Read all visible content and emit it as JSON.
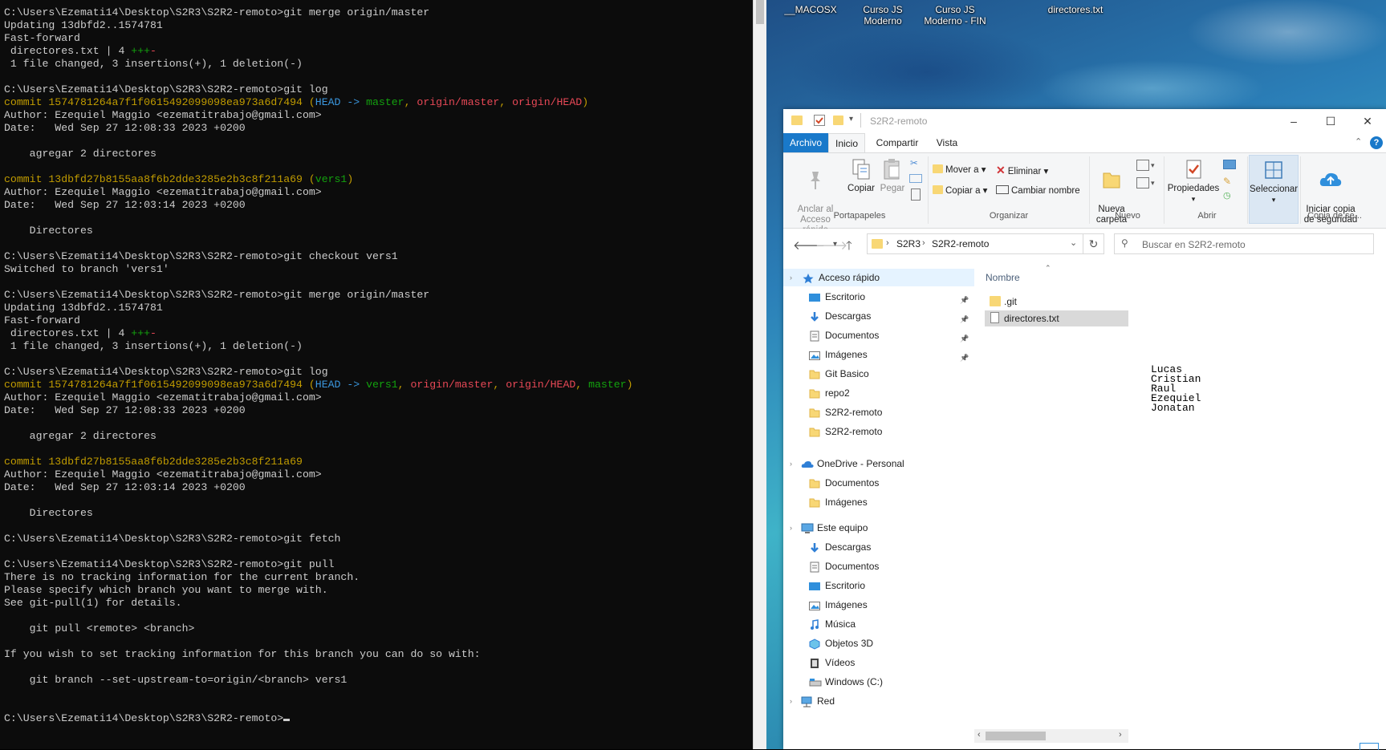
{
  "terminal": {
    "lines": [
      [
        {
          "t": "C:\\Users\\Ezemati14\\Desktop\\S2R3\\S2R2-remoto>git merge origin/master",
          "c": "w"
        }
      ],
      [
        {
          "t": "Updating 13dbfd2..1574781",
          "c": "w"
        }
      ],
      [
        {
          "t": "Fast-forward",
          "c": "w"
        }
      ],
      [
        {
          "t": " directores.txt | 4 ",
          "c": "w"
        },
        {
          "t": "+++",
          "c": "g"
        },
        {
          "t": "-",
          "c": "r"
        }
      ],
      [
        {
          "t": " 1 file changed, 3 insertions(+), 1 deletion(-)",
          "c": "w"
        }
      ],
      [],
      [
        {
          "t": "C:\\Users\\Ezemati14\\Desktop\\S2R3\\S2R2-remoto>git log",
          "c": "w"
        }
      ],
      [
        {
          "t": "commit 1574781264a7f1f0615492099098ea973a6d7494 (",
          "c": "y"
        },
        {
          "t": "HEAD -> ",
          "c": "c"
        },
        {
          "t": "master",
          "c": "g"
        },
        {
          "t": ", ",
          "c": "y"
        },
        {
          "t": "origin/master",
          "c": "r"
        },
        {
          "t": ", ",
          "c": "y"
        },
        {
          "t": "origin/HEAD",
          "c": "r"
        },
        {
          "t": ")",
          "c": "y"
        }
      ],
      [
        {
          "t": "Author: Ezequiel Maggio <ezematitrabajo@gmail.com>",
          "c": "w"
        }
      ],
      [
        {
          "t": "Date:   Wed Sep 27 12:08:33 2023 +0200",
          "c": "w"
        }
      ],
      [],
      [
        {
          "t": "    agregar 2 directores",
          "c": "w"
        }
      ],
      [],
      [
        {
          "t": "commit 13dbfd27b8155aa8f6b2dde3285e2b3c8f211a69 (",
          "c": "y"
        },
        {
          "t": "vers1",
          "c": "g"
        },
        {
          "t": ")",
          "c": "y"
        }
      ],
      [
        {
          "t": "Author: Ezequiel Maggio <ezematitrabajo@gmail.com>",
          "c": "w"
        }
      ],
      [
        {
          "t": "Date:   Wed Sep 27 12:03:14 2023 +0200",
          "c": "w"
        }
      ],
      [],
      [
        {
          "t": "    Directores",
          "c": "w"
        }
      ],
      [],
      [
        {
          "t": "C:\\Users\\Ezemati14\\Desktop\\S2R3\\S2R2-remoto>git checkout vers1",
          "c": "w"
        }
      ],
      [
        {
          "t": "Switched to branch 'vers1'",
          "c": "w"
        }
      ],
      [],
      [
        {
          "t": "C:\\Users\\Ezemati14\\Desktop\\S2R3\\S2R2-remoto>git merge origin/master",
          "c": "w"
        }
      ],
      [
        {
          "t": "Updating 13dbfd2..1574781",
          "c": "w"
        }
      ],
      [
        {
          "t": "Fast-forward",
          "c": "w"
        }
      ],
      [
        {
          "t": " directores.txt | 4 ",
          "c": "w"
        },
        {
          "t": "+++",
          "c": "g"
        },
        {
          "t": "-",
          "c": "r"
        }
      ],
      [
        {
          "t": " 1 file changed, 3 insertions(+), 1 deletion(-)",
          "c": "w"
        }
      ],
      [],
      [
        {
          "t": "C:\\Users\\Ezemati14\\Desktop\\S2R3\\S2R2-remoto>git log",
          "c": "w"
        }
      ],
      [
        {
          "t": "commit 1574781264a7f1f0615492099098ea973a6d7494 (",
          "c": "y"
        },
        {
          "t": "HEAD -> ",
          "c": "c"
        },
        {
          "t": "vers1",
          "c": "g"
        },
        {
          "t": ", ",
          "c": "y"
        },
        {
          "t": "origin/master",
          "c": "r"
        },
        {
          "t": ", ",
          "c": "y"
        },
        {
          "t": "origin/HEAD",
          "c": "r"
        },
        {
          "t": ", ",
          "c": "y"
        },
        {
          "t": "master",
          "c": "g"
        },
        {
          "t": ")",
          "c": "y"
        }
      ],
      [
        {
          "t": "Author: Ezequiel Maggio <ezematitrabajo@gmail.com>",
          "c": "w"
        }
      ],
      [
        {
          "t": "Date:   Wed Sep 27 12:08:33 2023 +0200",
          "c": "w"
        }
      ],
      [],
      [
        {
          "t": "    agregar 2 directores",
          "c": "w"
        }
      ],
      [],
      [
        {
          "t": "commit 13dbfd27b8155aa8f6b2dde3285e2b3c8f211a69",
          "c": "y"
        }
      ],
      [
        {
          "t": "Author: Ezequiel Maggio <ezematitrabajo@gmail.com>",
          "c": "w"
        }
      ],
      [
        {
          "t": "Date:   Wed Sep 27 12:03:14 2023 +0200",
          "c": "w"
        }
      ],
      [],
      [
        {
          "t": "    Directores",
          "c": "w"
        }
      ],
      [],
      [
        {
          "t": "C:\\Users\\Ezemati14\\Desktop\\S2R3\\S2R2-remoto>git fetch",
          "c": "w"
        }
      ],
      [],
      [
        {
          "t": "C:\\Users\\Ezemati14\\Desktop\\S2R3\\S2R2-remoto>git pull",
          "c": "w"
        }
      ],
      [
        {
          "t": "There is no tracking information for the current branch.",
          "c": "w"
        }
      ],
      [
        {
          "t": "Please specify which branch you want to merge with.",
          "c": "w"
        }
      ],
      [
        {
          "t": "See git-pull(1) for details.",
          "c": "w"
        }
      ],
      [],
      [
        {
          "t": "    git pull <remote> <branch>",
          "c": "w"
        }
      ],
      [],
      [
        {
          "t": "If you wish to set tracking information for this branch you can do so with:",
          "c": "w"
        }
      ],
      [],
      [
        {
          "t": "    git branch --set-upstream-to=origin/<branch> vers1",
          "c": "w"
        }
      ],
      [],
      [],
      [
        {
          "t": "C:\\Users\\Ezemati14\\Desktop\\S2R3\\S2R2-remoto>",
          "c": "w"
        }
      ]
    ]
  },
  "desktop": {
    "icons": [
      "__MACOSX",
      "Curso JS\nModerno",
      "Curso JS\nModerno - FIN",
      "directores.txt"
    ]
  },
  "explorer": {
    "title": "S2R2-remoto",
    "tabs": [
      "Archivo",
      "Inicio",
      "Compartir",
      "Vista"
    ],
    "ribbon": {
      "pin_label": "Anclar al\nAcceso rápido",
      "copy_label": "Copiar",
      "paste_label": "Pegar",
      "move_label": "Mover a",
      "copyto_label": "Copiar a",
      "delete_label": "Eliminar",
      "rename_label": "Cambiar nombre",
      "newfolder_label": "Nueva\ncarpeta",
      "properties_label": "Propiedades",
      "select_label": "Seleccionar",
      "backup_label": "Iniciar copia\nde seguridad",
      "groups": {
        "clipboard": "Portapapeles",
        "organize": "Organizar",
        "new": "Nuevo",
        "open": "Abrir",
        "backup": "Copia de se..."
      }
    },
    "address": {
      "crumbs": [
        "S2R3",
        "S2R2-remoto"
      ],
      "search_placeholder": "Buscar en S2R2-remoto"
    },
    "nav": {
      "quick_access": "Acceso rápido",
      "quick_items": [
        {
          "label": "Escritorio",
          "icon": "desktop-icon",
          "pinned": true
        },
        {
          "label": "Descargas",
          "icon": "download-icon",
          "pinned": true
        },
        {
          "label": "Documentos",
          "icon": "document-icon",
          "pinned": true
        },
        {
          "label": "Imágenes",
          "icon": "pictures-icon",
          "pinned": true
        },
        {
          "label": "Git Basico",
          "icon": "folder-icon",
          "pinned": false
        },
        {
          "label": "repo2",
          "icon": "folder-icon",
          "pinned": false
        },
        {
          "label": "S2R2-remoto",
          "icon": "folder-icon",
          "pinned": false
        },
        {
          "label": "S2R2-remoto",
          "icon": "folder-icon",
          "pinned": false
        }
      ],
      "onedrive": "OneDrive - Personal",
      "onedrive_items": [
        "Documentos",
        "Imágenes"
      ],
      "this_pc": "Este equipo",
      "pc_items": [
        {
          "label": "Descargas",
          "icon": "download-icon"
        },
        {
          "label": "Documentos",
          "icon": "document-icon"
        },
        {
          "label": "Escritorio",
          "icon": "desktop-icon"
        },
        {
          "label": "Imágenes",
          "icon": "pictures-icon"
        },
        {
          "label": "Música",
          "icon": "music-icon"
        },
        {
          "label": "Objetos 3D",
          "icon": "cube-icon"
        },
        {
          "label": "Vídeos",
          "icon": "video-icon"
        },
        {
          "label": "Windows (C:)",
          "icon": "drive-icon"
        }
      ],
      "network": "Red"
    },
    "files": {
      "column_header": "Nombre",
      "items": [
        {
          "name": ".git",
          "type": "folder"
        },
        {
          "name": "directores.txt",
          "type": "text"
        }
      ],
      "selected": "directores.txt"
    },
    "preview_lines": [
      "Lucas",
      "Cristian",
      "Raul",
      "Ezequiel",
      "Jonatan"
    ]
  },
  "colors": {
    "terminal_bg": "#0c0c0c",
    "terminal_fg": "#cccccc",
    "commit_yellow": "#c19c00",
    "head_cyan": "#3a96dd",
    "branch_green": "#13a10e",
    "remote_red": "#e74856",
    "archivo_blue": "#1979ca",
    "selection_gray": "#d9d9d9"
  }
}
